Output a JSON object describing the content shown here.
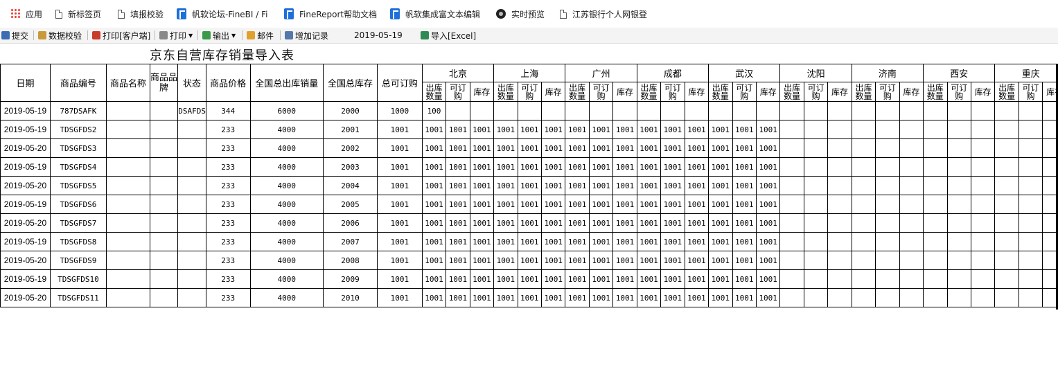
{
  "bookmarks": [
    {
      "label": "应用",
      "icon": "apps-grid-icon"
    },
    {
      "label": "新标签页",
      "icon": "page-icon"
    },
    {
      "label": "填报校验",
      "icon": "page-icon"
    },
    {
      "label": "帆软论坛-FineBI / Fi",
      "icon": "finereport-icon"
    },
    {
      "label": "FineReport帮助文档",
      "icon": "finereport-icon"
    },
    {
      "label": "帆软集成富文本编辑",
      "icon": "finereport-icon"
    },
    {
      "label": "实时预览",
      "icon": "camera-icon"
    },
    {
      "label": "江苏银行个人网银登",
      "icon": "page-icon"
    }
  ],
  "toolbar": {
    "submit": "提交",
    "validate": "数据校验",
    "print_client": "打印[客户端]",
    "print": "打印",
    "export": "输出",
    "mail": "邮件",
    "add_record": "增加记录",
    "date": "2019-05-19",
    "import_excel": "导入[Excel]"
  },
  "report": {
    "title": "京东自营库存销量导入表",
    "headers": {
      "date": "日期",
      "code": "商品编号",
      "name": "商品名称",
      "brand": "商品品牌",
      "status": "状态",
      "price": "商品价格",
      "total_out": "全国总出库销量",
      "total_stock": "全国总库存",
      "orderable": "总可订购"
    },
    "cities": [
      "北京",
      "上海",
      "广州",
      "成都",
      "武汉",
      "沈阳",
      "济南",
      "西安",
      "重庆"
    ],
    "sub_headers": [
      "出库数量",
      "可订购",
      "库存"
    ],
    "rows": [
      {
        "date": "2019-05-19",
        "code": "787DSAFK",
        "name": "",
        "brand": "",
        "status": "DSAFDS",
        "price": "344",
        "total_out": "6000",
        "total_stock": "2000",
        "orderable": "1000",
        "filled": 1,
        "city_value": "100"
      },
      {
        "date": "2019-05-19",
        "code": "TDSGFDS2",
        "name": "",
        "brand": "",
        "status": "",
        "price": "233",
        "total_out": "4000",
        "total_stock": "2001",
        "orderable": "1001",
        "filled": 15,
        "city_value": "1001"
      },
      {
        "date": "2019-05-20",
        "code": "TDSGFDS3",
        "name": "",
        "brand": "",
        "status": "",
        "price": "233",
        "total_out": "4000",
        "total_stock": "2002",
        "orderable": "1001",
        "filled": 15,
        "city_value": "1001"
      },
      {
        "date": "2019-05-19",
        "code": "TDSGFDS4",
        "name": "",
        "brand": "",
        "status": "",
        "price": "233",
        "total_out": "4000",
        "total_stock": "2003",
        "orderable": "1001",
        "filled": 15,
        "city_value": "1001"
      },
      {
        "date": "2019-05-20",
        "code": "TDSGFDS5",
        "name": "",
        "brand": "",
        "status": "",
        "price": "233",
        "total_out": "4000",
        "total_stock": "2004",
        "orderable": "1001",
        "filled": 15,
        "city_value": "1001"
      },
      {
        "date": "2019-05-19",
        "code": "TDSGFDS6",
        "name": "",
        "brand": "",
        "status": "",
        "price": "233",
        "total_out": "4000",
        "total_stock": "2005",
        "orderable": "1001",
        "filled": 15,
        "city_value": "1001"
      },
      {
        "date": "2019-05-20",
        "code": "TDSGFDS7",
        "name": "",
        "brand": "",
        "status": "",
        "price": "233",
        "total_out": "4000",
        "total_stock": "2006",
        "orderable": "1001",
        "filled": 15,
        "city_value": "1001"
      },
      {
        "date": "2019-05-19",
        "code": "TDSGFDS8",
        "name": "",
        "brand": "",
        "status": "",
        "price": "233",
        "total_out": "4000",
        "total_stock": "2007",
        "orderable": "1001",
        "filled": 15,
        "city_value": "1001"
      },
      {
        "date": "2019-05-20",
        "code": "TDSGFDS9",
        "name": "",
        "brand": "",
        "status": "",
        "price": "233",
        "total_out": "4000",
        "total_stock": "2008",
        "orderable": "1001",
        "filled": 15,
        "city_value": "1001"
      },
      {
        "date": "2019-05-19",
        "code": "TDSGFDS10",
        "name": "",
        "brand": "",
        "status": "",
        "price": "233",
        "total_out": "4000",
        "total_stock": "2009",
        "orderable": "1001",
        "filled": 15,
        "city_value": "1001"
      },
      {
        "date": "2019-05-20",
        "code": "TDSGFDS11",
        "name": "",
        "brand": "",
        "status": "",
        "price": "233",
        "total_out": "4000",
        "total_stock": "2010",
        "orderable": "1001",
        "filled": 15,
        "city_value": "1001"
      }
    ]
  }
}
